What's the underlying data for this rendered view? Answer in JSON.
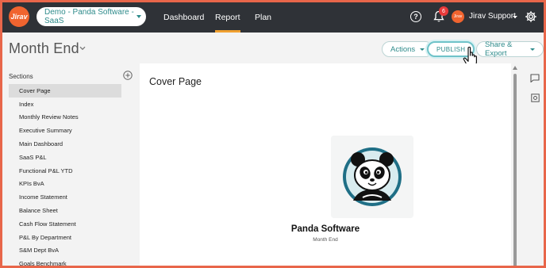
{
  "app": {
    "logo_text": "Jirav"
  },
  "header": {
    "company_select": "Demo - Panda Software - SaaS",
    "nav": [
      {
        "label": "Dashboard",
        "active": false
      },
      {
        "label": "Report",
        "active": true
      },
      {
        "label": "Plan",
        "active": false
      }
    ],
    "help_symbol": "?",
    "notification_count": "6",
    "avatar_text": "Jirav",
    "user_name": "Jirav Support"
  },
  "page": {
    "title": "Month End",
    "buttons": {
      "actions": "Actions",
      "publish": "PUBLISH",
      "share_export": "Share & Export"
    }
  },
  "sidebar": {
    "heading": "Sections",
    "items": [
      {
        "label": "Cover Page",
        "active": true
      },
      {
        "label": "Index"
      },
      {
        "label": "Monthly Review Notes"
      },
      {
        "label": "Executive Summary"
      },
      {
        "label": "Main Dashboard"
      },
      {
        "label": "SaaS P&L"
      },
      {
        "label": "Functional P&L YTD"
      },
      {
        "label": "KPIs BvA"
      },
      {
        "label": "Income Statement"
      },
      {
        "label": "Balance Sheet"
      },
      {
        "label": "Cash Flow Statement"
      },
      {
        "label": "P&L By Department"
      },
      {
        "label": "S&M Dept BvA"
      },
      {
        "label": "Goals Benchmark"
      }
    ]
  },
  "content": {
    "card_title": "Cover Page",
    "company_name": "Panda Software",
    "subtitle": "Month End"
  },
  "colors": {
    "accent": "#2e8b8b",
    "brand": "#f0642f",
    "topbar": "#2f3237",
    "active_tab_underline": "#f0a030"
  }
}
